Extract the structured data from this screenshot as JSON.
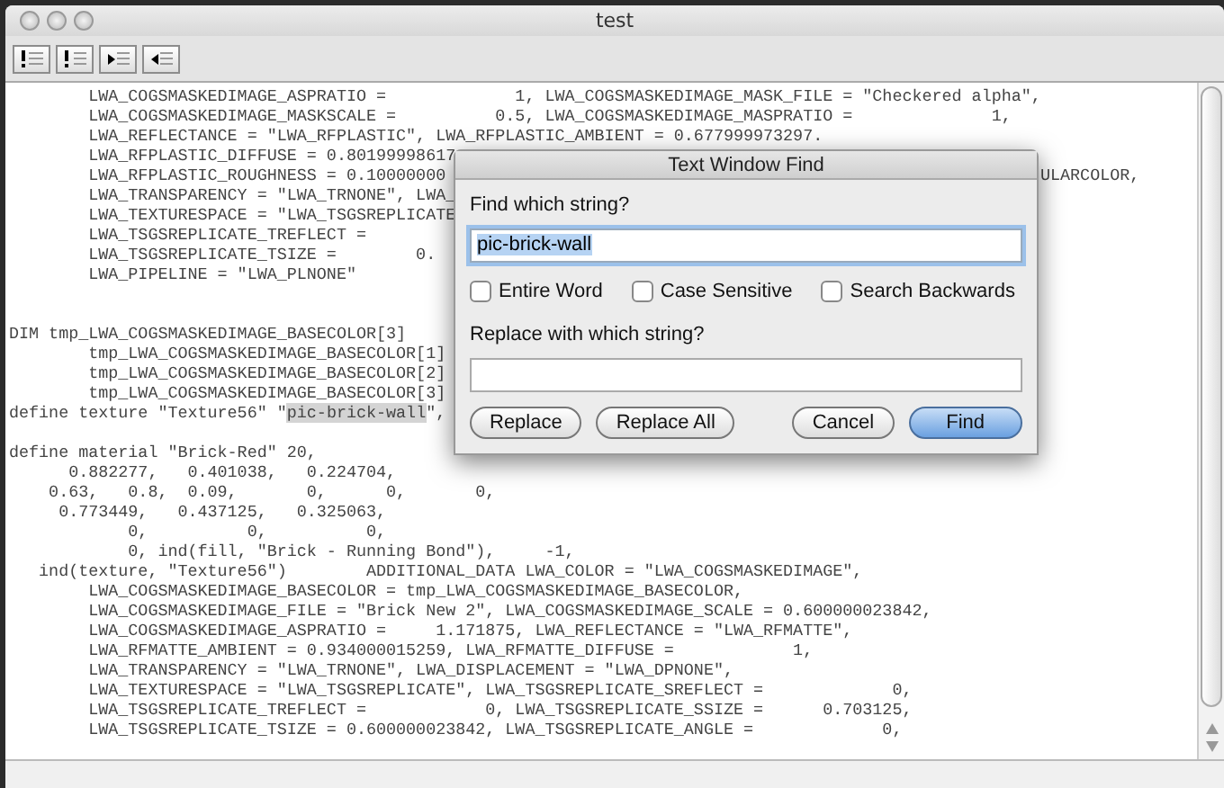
{
  "window": {
    "title": "test"
  },
  "toolbar": {
    "buttons": [
      {
        "kind": "bang-lines"
      },
      {
        "kind": "bang-indent"
      },
      {
        "kind": "arrow-right"
      },
      {
        "kind": "arrow-left"
      }
    ]
  },
  "editor": {
    "lines": [
      {
        "text": "        LWA_COGSMASKEDIMAGE_ASPRATIO =             1, LWA_COGSMASKEDIMAGE_MASK_FILE = \"Checkered alpha\","
      },
      {
        "text": "        LWA_COGSMASKEDIMAGE_MASKSCALE =          0.5, LWA_COGSMASKEDIMAGE_MASPRATIO =              1,"
      },
      {
        "text": "        LWA_REFLECTANCE = \"LWA_RFPLASTIC\", LWA_RFPLASTIC_AMBIENT = 0.677999973297."
      },
      {
        "text": "        LWA_RFPLASTIC_DIFFUSE = 0.80199998617"
      },
      {
        "text": "        LWA_RFPLASTIC_ROUGHNESS = 0.10000000",
        "right": "ULARCOLOR,"
      },
      {
        "text": "        LWA_TRANSPARENCY = \"LWA_TRNONE\", LWA_"
      },
      {
        "text": "        LWA_TEXTURESPACE = \"LWA_TSGSREPLICATE"
      },
      {
        "text": "        LWA_TSGSREPLICATE_TREFLECT ="
      },
      {
        "text": "        LWA_TSGSREPLICATE_TSIZE =        0."
      },
      {
        "text": "        LWA_PIPELINE = \"LWA_PLNONE\""
      },
      {
        "blank": true
      },
      {
        "blank": true
      },
      {
        "text": "DIM tmp_LWA_COGSMASKEDIMAGE_BASECOLOR[3]"
      },
      {
        "text": "        tmp_LWA_COGSMASKEDIMAGE_BASECOLOR[1]"
      },
      {
        "text": "        tmp_LWA_COGSMASKEDIMAGE_BASECOLOR[2]"
      },
      {
        "text": "        tmp_LWA_COGSMASKEDIMAGE_BASECOLOR[3]"
      },
      {
        "text": "define texture \"Texture56\" \"",
        "found": "pic-brick-wall",
        "after": "\","
      },
      {
        "blank": true
      },
      {
        "text": "define material \"Brick-Red\" 20,"
      },
      {
        "text": "      0.882277,   0.401038,   0.224704,"
      },
      {
        "text": "    0.63,   0.8,  0.09,       0,      0,       0,"
      },
      {
        "text": "     0.773449,   0.437125,   0.325063,"
      },
      {
        "text": "            0,          0,          0,"
      },
      {
        "text": "            0, ind(fill, \"Brick - Running Bond\"),     -1,"
      },
      {
        "text": "   ind(texture, \"Texture56\")        ADDITIONAL_DATA LWA_COLOR = \"LWA_COGSMASKEDIMAGE\","
      },
      {
        "text": "        LWA_COGSMASKEDIMAGE_BASECOLOR = tmp_LWA_COGSMASKEDIMAGE_BASECOLOR,"
      },
      {
        "text": "        LWA_COGSMASKEDIMAGE_FILE = \"Brick New 2\", LWA_COGSMASKEDIMAGE_SCALE = 0.600000023842,"
      },
      {
        "text": "        LWA_COGSMASKEDIMAGE_ASPRATIO =     1.171875, LWA_REFLECTANCE = \"LWA_RFMATTE\","
      },
      {
        "text": "        LWA_RFMATTE_AMBIENT = 0.934000015259, LWA_RFMATTE_DIFFUSE =            1,"
      },
      {
        "text": "        LWA_TRANSPARENCY = \"LWA_TRNONE\", LWA_DISPLACEMENT = \"LWA_DPNONE\","
      },
      {
        "text": "        LWA_TEXTURESPACE = \"LWA_TSGSREPLICATE\", LWA_TSGSREPLICATE_SREFLECT =             0,"
      },
      {
        "text": "        LWA_TSGSREPLICATE_TREFLECT =            0, LWA_TSGSREPLICATE_SSIZE =      0.703125,"
      },
      {
        "text": "        LWA_TSGSREPLICATE_TSIZE = 0.600000023842, LWA_TSGSREPLICATE_ANGLE =             0,"
      }
    ]
  },
  "find_dialog": {
    "title": "Text Window Find",
    "find_label": "Find which string?",
    "find_value": "pic-brick-wall",
    "options": [
      {
        "label": "Entire Word",
        "checked": false
      },
      {
        "label": "Case Sensitive",
        "checked": false
      },
      {
        "label": "Search Backwards",
        "checked": false
      }
    ],
    "replace_label": "Replace with which string?",
    "buttons": [
      {
        "label": "Replace",
        "default": false
      },
      {
        "label": "Replace All",
        "default": false
      },
      {
        "label": "Cancel",
        "default": false
      },
      {
        "label": "Find",
        "default": true
      }
    ]
  }
}
